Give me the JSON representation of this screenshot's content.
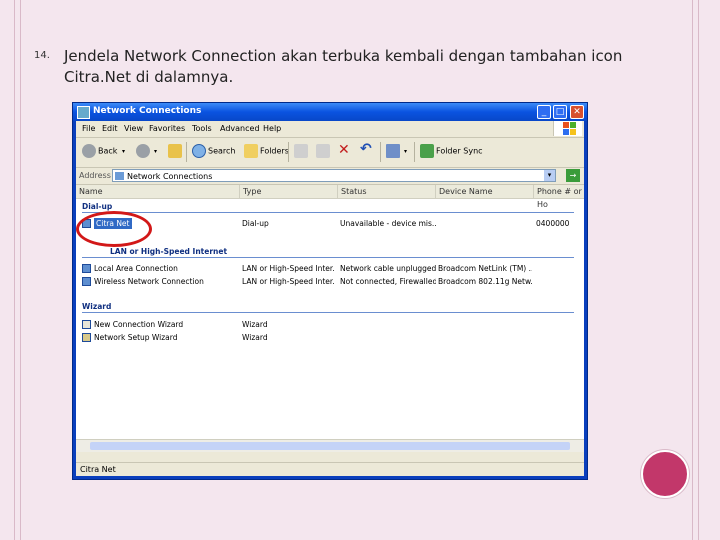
{
  "slide": {
    "number": "14.",
    "text": "Jendela Network Connection akan terbuka kembali dengan tambahan icon Citra.Net di dalamnya."
  },
  "window": {
    "title": "Network Connections",
    "menu": [
      "File",
      "Edit",
      "View",
      "Favorites",
      "Tools",
      "Advanced",
      "Help"
    ],
    "toolbar": {
      "back": "Back",
      "search": "Search",
      "folders": "Folders",
      "folder_sync": "Folder Sync"
    },
    "address": {
      "label": "Address",
      "value": "Network Connections",
      "go": "Go"
    },
    "columns": [
      "Name",
      "Type",
      "Status",
      "Device Name",
      "Phone # or Ho"
    ],
    "groups": {
      "dialup": {
        "title": "Dial-up",
        "rows": [
          {
            "name": "Citra Net",
            "type": "Dial-up",
            "status": "Unavailable - device mis...",
            "device": "",
            "phone": "0400000"
          }
        ]
      },
      "lan": {
        "title": "LAN or High-Speed Internet",
        "rows": [
          {
            "name": "Local Area Connection",
            "type": "LAN or High-Speed Inter...",
            "status": "Network cable unplugged ...",
            "device": "Broadcom NetLink (TM) ..."
          },
          {
            "name": "Wireless Network Connection",
            "type": "LAN or High-Speed Inter...",
            "status": "Not connected, Firewalled",
            "device": "Broadcom 802.11g Netw..."
          }
        ]
      },
      "wizard": {
        "title": "Wizard",
        "rows": [
          {
            "name": "New Connection Wizard",
            "type": "Wizard"
          },
          {
            "name": "Network Setup Wizard",
            "type": "Wizard"
          }
        ]
      }
    },
    "status_text": "Citra Net"
  }
}
